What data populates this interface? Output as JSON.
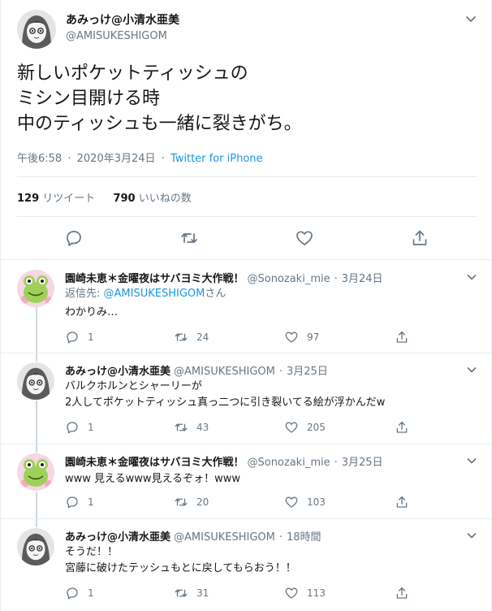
{
  "main_tweet": {
    "author_name": "あみっけ@小清水亜美",
    "handle": "@AMISUKESHIGOM",
    "text_lines": [
      "新しいポケットティッシュの",
      "ミシン目開ける時",
      "中のティッシュも一緒に裂きがち。"
    ],
    "time": "午後6:58",
    "date": "2020年3月24日",
    "source": "Twitter for iPhone",
    "retweets_count": "129",
    "retweets_label": "リツイート",
    "likes_count": "790",
    "likes_label": "いいねの数",
    "dot": "·"
  },
  "replies": [
    {
      "author_name": "園崎未恵＊金曜夜はサバヨミ大作戦！",
      "handle": "@Sonozaki_mie",
      "date": "3月24日",
      "reply_to_prefix": "返信先: ",
      "reply_to_handle": "@AMISUKESHIGOM",
      "reply_to_suffix": "さん",
      "lines": [
        "わかりみ…"
      ],
      "replies": "1",
      "retweets": "24",
      "likes": "97"
    },
    {
      "author_name": "あみっけ@小清水亜美",
      "handle": "@AMISUKESHIGOM",
      "date": "3月25日",
      "lines": [
        "バルクホルンとシャーリーが",
        "2人してポケットティッシュ真っ二つに引き裂いてる絵が浮かんだw"
      ],
      "replies": "1",
      "retweets": "43",
      "likes": "205"
    },
    {
      "author_name": "園崎未恵＊金曜夜はサバヨミ大作戦！",
      "handle": "@Sonozaki_mie",
      "date": "3月25日",
      "lines": [
        "www 見えるwww見えるぞォ！www"
      ],
      "replies": "1",
      "retweets": "20",
      "likes": "103"
    },
    {
      "author_name": "あみっけ@小清水亜美",
      "handle": "@AMISUKESHIGOM",
      "date": "18時間",
      "lines": [
        "そうだ！！",
        "宮藤に破けたテッシュもとに戻してもらおう！！"
      ],
      "replies": "1",
      "retweets": "31",
      "likes": "113"
    }
  ],
  "colors": {
    "text": "#14171a",
    "secondary": "#657786",
    "link": "#1b95e0",
    "border": "#e6ecf0",
    "thread_line": "#ccd6dd"
  },
  "icons": [
    "chevron-down-icon",
    "reply-icon",
    "retweet-icon",
    "like-icon",
    "share-icon"
  ]
}
